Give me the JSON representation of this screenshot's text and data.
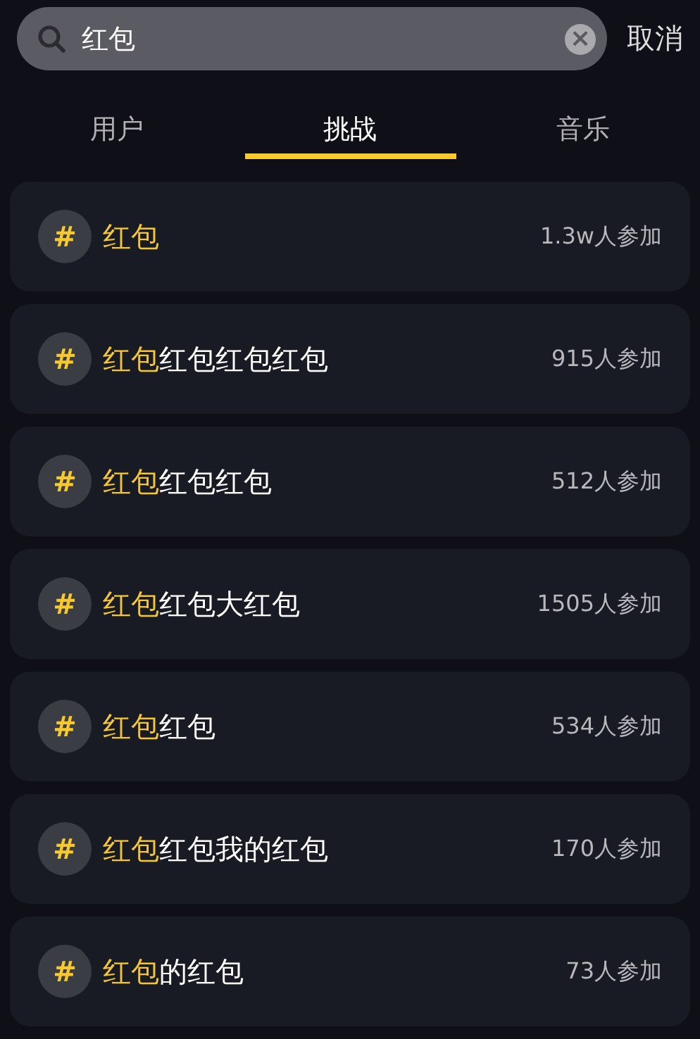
{
  "search": {
    "value": "红包",
    "clear_symbol": "×",
    "cancel": "取消"
  },
  "tabs": [
    {
      "label": "用户",
      "selected": false
    },
    {
      "label": "挑战",
      "selected": true
    },
    {
      "label": "音乐",
      "selected": false
    }
  ],
  "results": [
    {
      "symbol": "#",
      "highlight": "红包",
      "count": "1.3w人参加"
    },
    {
      "symbol": "#",
      "highlight": "红包",
      "rest": "红包红包红包",
      "count": "915人参加"
    },
    {
      "symbol": "#",
      "highlight": "红包",
      "rest": "红包红包",
      "count": "512人参加"
    },
    {
      "symbol": "#",
      "highlight": "红包",
      "rest": "红包大红包",
      "count": "1505人参加"
    },
    {
      "symbol": "#",
      "highlight": "红包",
      "rest": "红包",
      "count": "534人参加"
    },
    {
      "symbol": "#",
      "highlight": "红包",
      "rest": "红包我的红包",
      "count": "170人参加"
    },
    {
      "symbol": "#",
      "highlight": "红包",
      "rest": "的红包",
      "count": "73人参加"
    }
  ]
}
